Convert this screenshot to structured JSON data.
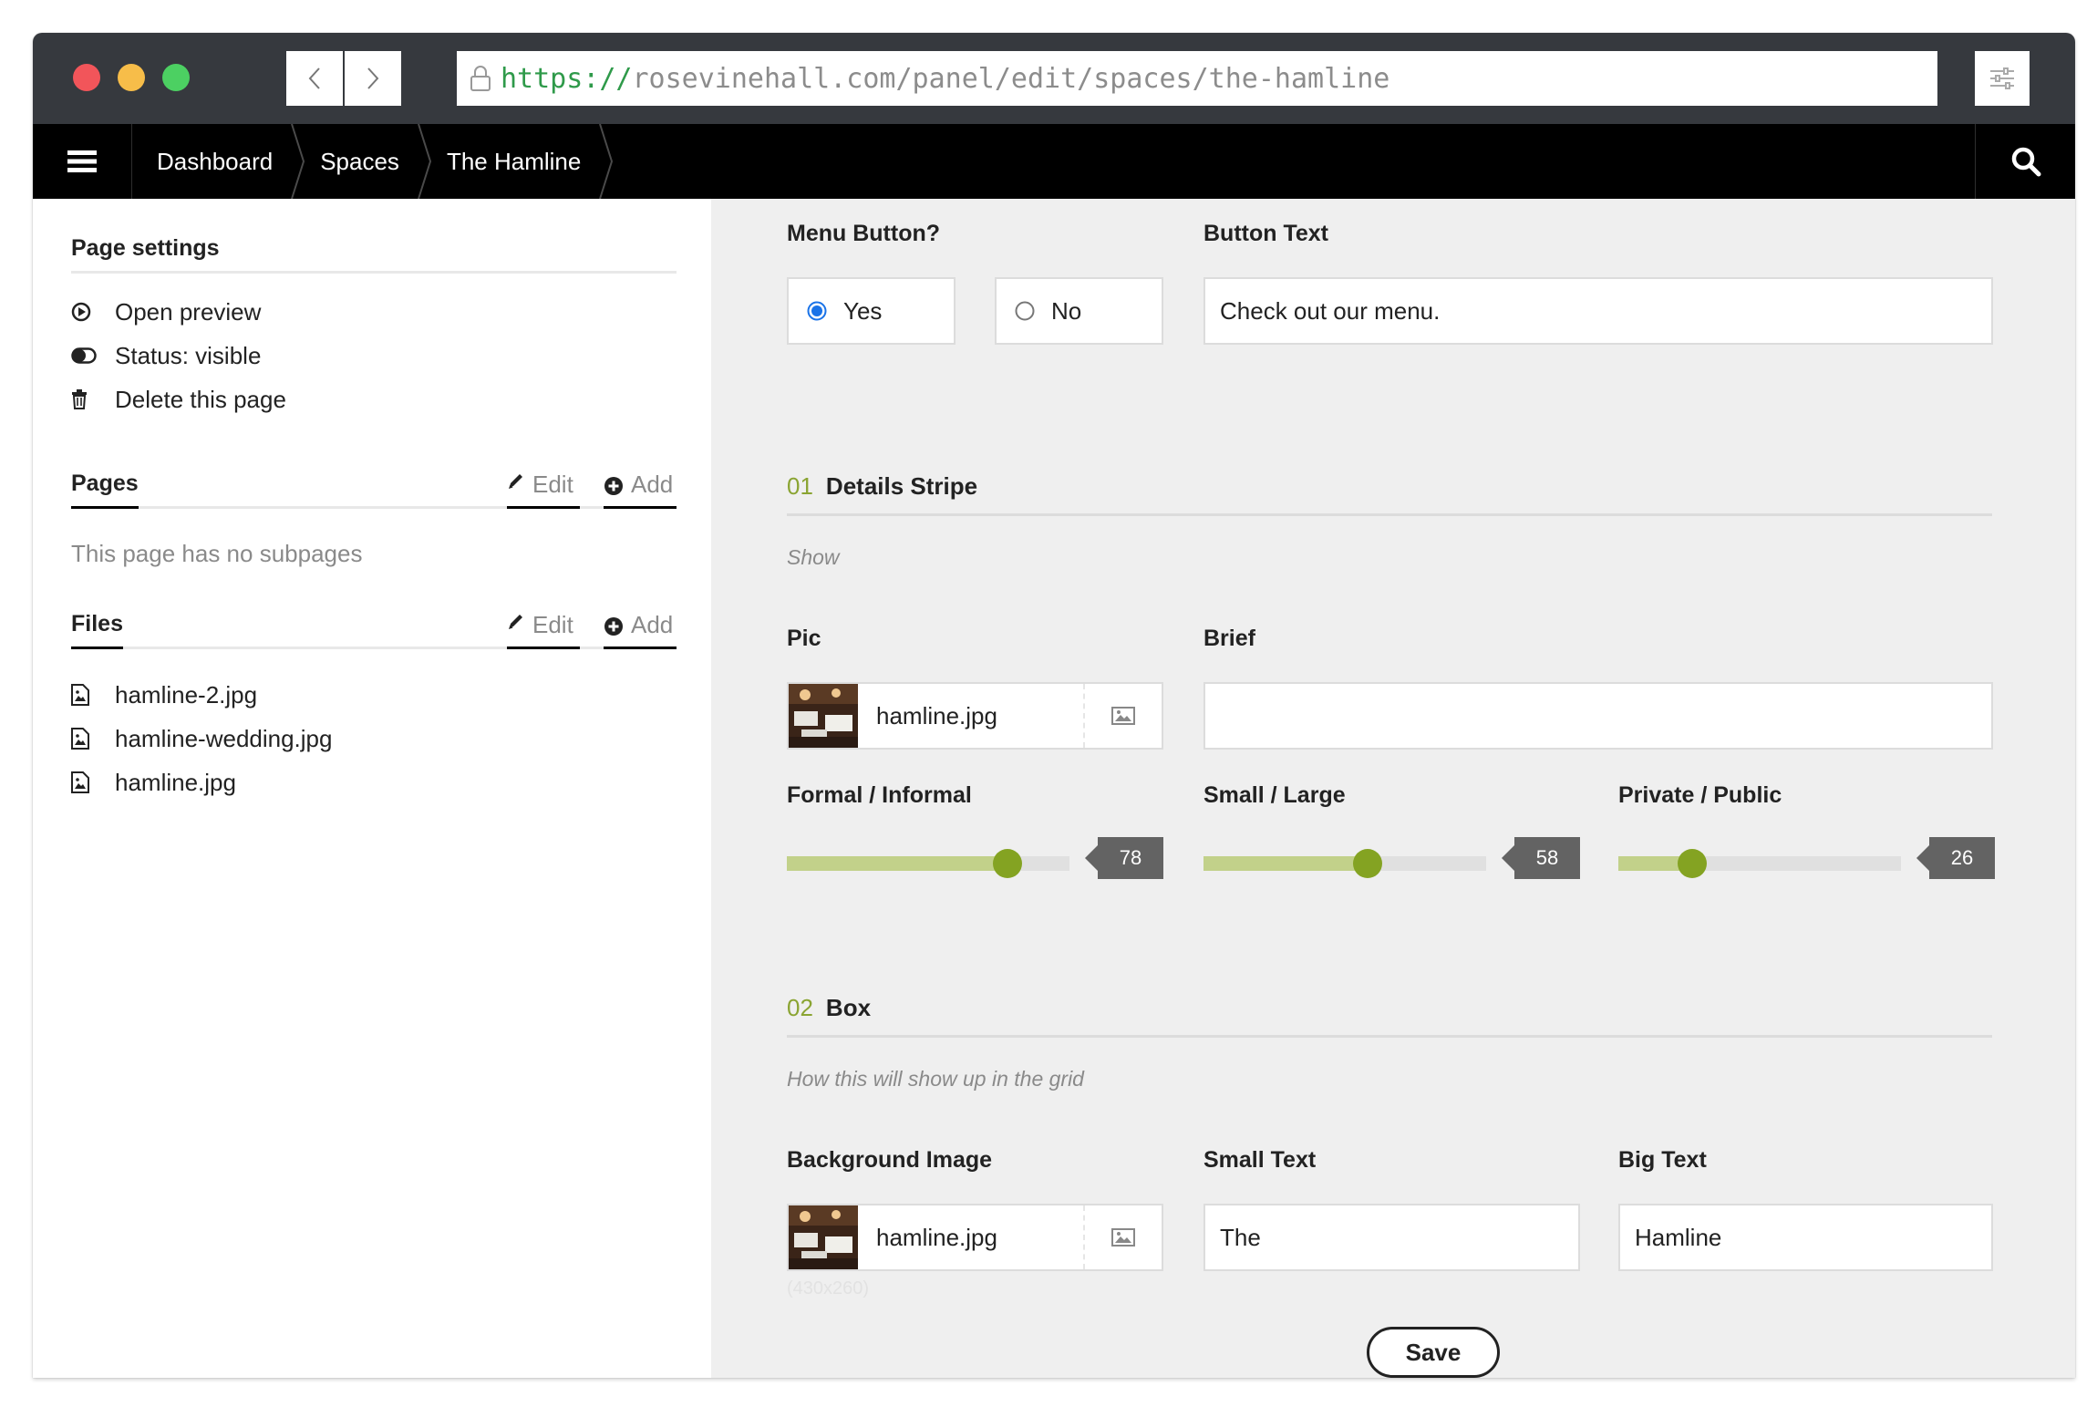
{
  "browser": {
    "url_scheme": "https://",
    "url_rest": "rosevinehall.com/panel/edit/spaces/the-hamline"
  },
  "breadcrumb": [
    "Dashboard",
    "Spaces",
    "The Hamline"
  ],
  "sidebar": {
    "page_settings": {
      "title": "Page settings",
      "items": [
        {
          "icon": "preview-icon",
          "label": "Open preview"
        },
        {
          "icon": "toggle-icon",
          "label": "Status: visible"
        },
        {
          "icon": "trash-icon",
          "label": "Delete this page"
        }
      ]
    },
    "pages": {
      "title": "Pages",
      "edit_label": "Edit",
      "add_label": "Add",
      "empty_text": "This page has no subpages"
    },
    "files": {
      "title": "Files",
      "edit_label": "Edit",
      "add_label": "Add",
      "items": [
        "hamline-2.jpg",
        "hamline-wedding.jpg",
        "hamline.jpg"
      ]
    }
  },
  "form": {
    "menu_button": {
      "label": "Menu Button?",
      "options": [
        "Yes",
        "No"
      ],
      "selected": "Yes"
    },
    "button_text": {
      "label": "Button Text",
      "value": "Check out our menu."
    },
    "section1": {
      "number": "01",
      "title": "Details Stripe",
      "subtitle": "Show"
    },
    "pic": {
      "label": "Pic",
      "file": "hamline.jpg"
    },
    "brief": {
      "label": "Brief",
      "value": ""
    },
    "sliders": [
      {
        "label": "Formal / Informal",
        "value": 78
      },
      {
        "label": "Small / Large",
        "value": 58
      },
      {
        "label": "Private / Public",
        "value": 26
      }
    ],
    "section2": {
      "number": "02",
      "title": "Box",
      "subtitle": "How this will show up in the grid"
    },
    "background_image": {
      "label": "Background Image",
      "file": "hamline.jpg",
      "hint": "(430x260)"
    },
    "small_text": {
      "label": "Small Text",
      "value": "The"
    },
    "big_text": {
      "label": "Big Text",
      "value": "Hamline"
    },
    "save_label": "Save"
  },
  "colors": {
    "accent": "#84a322",
    "accent_light": "#c2d18a",
    "section_number": "#8aa432",
    "topbar": "#000000",
    "chrome": "#36393e"
  }
}
